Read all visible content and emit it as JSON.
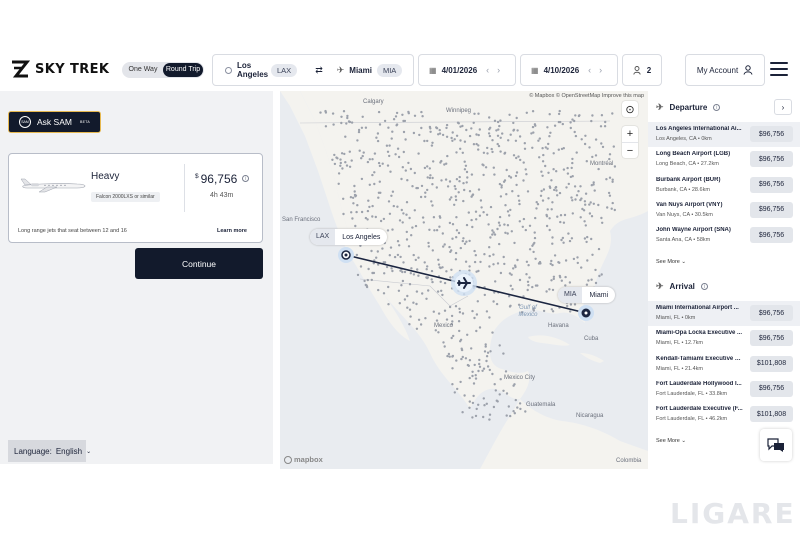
{
  "brand": {
    "name": "SKY TREK"
  },
  "trip_type": {
    "one_way": "One Way",
    "round_trip": "Round Trip",
    "selected": "Round Trip"
  },
  "search": {
    "origin": {
      "city": "Los Angeles",
      "code": "LAX"
    },
    "destination": {
      "city": "Miami",
      "code": "MIA"
    },
    "depart_date": "4/01/2026",
    "return_date": "4/10/2026",
    "passengers": "2"
  },
  "account": {
    "label": "My Account"
  },
  "ask_sam": {
    "badge": "SAM",
    "label": "Ask SAM",
    "tag": "BETA"
  },
  "jet": {
    "class": "Heavy",
    "model": "Falcon 2000LXS or similar",
    "currency": "$",
    "price": "96,756",
    "duration": "4h 43m",
    "description": "Long range jets that seat between 12 and 16",
    "learn_more": "Learn more"
  },
  "continue_label": "Continue",
  "language": {
    "label": "Language:",
    "value": "English"
  },
  "map": {
    "attribution": "© Mapbox © OpenStreetMap  Improve this map",
    "origin_code": "LAX",
    "origin_city": "Los Angeles",
    "dest_code": "MIA",
    "dest_city": "Miami",
    "labels": {
      "calgary": "Calgary",
      "winnipeg": "Winnipeg",
      "montreal": "Montréal",
      "sanfrancisco": "San Francisco",
      "mexico": "Mexico",
      "mexicocity": "Mexico City",
      "havana": "Havana",
      "cuba": "Cuba",
      "guatemala": "Guatemala",
      "nicaragua": "Nicaragua",
      "colombia": "Colombia"
    },
    "water": {
      "gulf": "Gulf of Mexico"
    },
    "logo": "mapbox"
  },
  "departure": {
    "title": "Departure",
    "airports": [
      {
        "name": "Los Angeles International Ai...",
        "sub": "Los Angeles, CA • 0km",
        "price": "$96,756"
      },
      {
        "name": "Long Beach Airport (LGB)",
        "sub": "Long Beach, CA • 27.2km",
        "price": "$96,756"
      },
      {
        "name": "Burbank Airport (BUR)",
        "sub": "Burbank, CA • 28.6km",
        "price": "$96,756"
      },
      {
        "name": "Van Nuys Airport (VNY)",
        "sub": "Van Nuys, CA • 30.5km",
        "price": "$96,756"
      },
      {
        "name": "John Wayne Airport (SNA)",
        "sub": "Santa Ana, CA • 58km",
        "price": "$96,756"
      }
    ],
    "see_more": "See More"
  },
  "arrival": {
    "title": "Arrival",
    "airports": [
      {
        "name": "Miami International Airport ...",
        "sub": "Miami, FL • 0km",
        "price": "$96,756"
      },
      {
        "name": "Miami-Opa Locka Executive ...",
        "sub": "Miami, FL • 12.7km",
        "price": "$96,756"
      },
      {
        "name": "Kendall-Tamiami Executive A...",
        "sub": "Miami, FL • 21.4km",
        "price": "$101,808"
      },
      {
        "name": "Fort Lauderdale Hollywood I...",
        "sub": "Fort Lauderdale, FL • 33.8km",
        "price": "$96,756"
      },
      {
        "name": "Fort Lauderdale Executive (F...",
        "sub": "Fort Lauderdale, FL • 46.2km",
        "price": "$101,808"
      }
    ],
    "see_more": "See More"
  },
  "watermark": "LIGARE"
}
